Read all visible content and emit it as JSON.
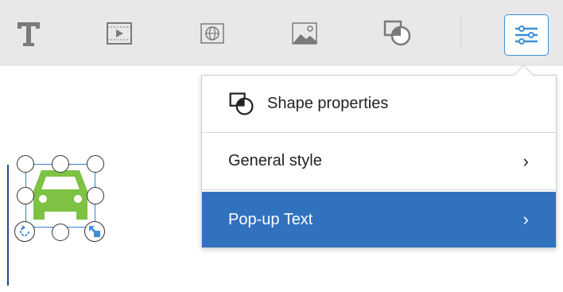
{
  "toolbar": {
    "items": [
      {
        "name": "text-tool",
        "icon": "text-T-icon"
      },
      {
        "name": "video-tool",
        "icon": "video-icon"
      },
      {
        "name": "web-tool",
        "icon": "globe-icon"
      },
      {
        "name": "image-tool",
        "icon": "image-icon"
      },
      {
        "name": "shape-tool",
        "icon": "shape-icon"
      },
      {
        "name": "properties-tool",
        "icon": "sliders-icon",
        "active": true
      }
    ]
  },
  "menu": {
    "header_label": "Shape properties",
    "items": [
      {
        "label": "General style",
        "selected": false
      },
      {
        "label": "Pop-up Text",
        "selected": true
      }
    ]
  },
  "canvas": {
    "selected_shape_icon": "car-icon"
  },
  "colors": {
    "toolbar_bg": "#e8e8e8",
    "accent": "#3d8fd6",
    "selected_row": "#3172bf",
    "shape_fill": "#7dc242"
  }
}
